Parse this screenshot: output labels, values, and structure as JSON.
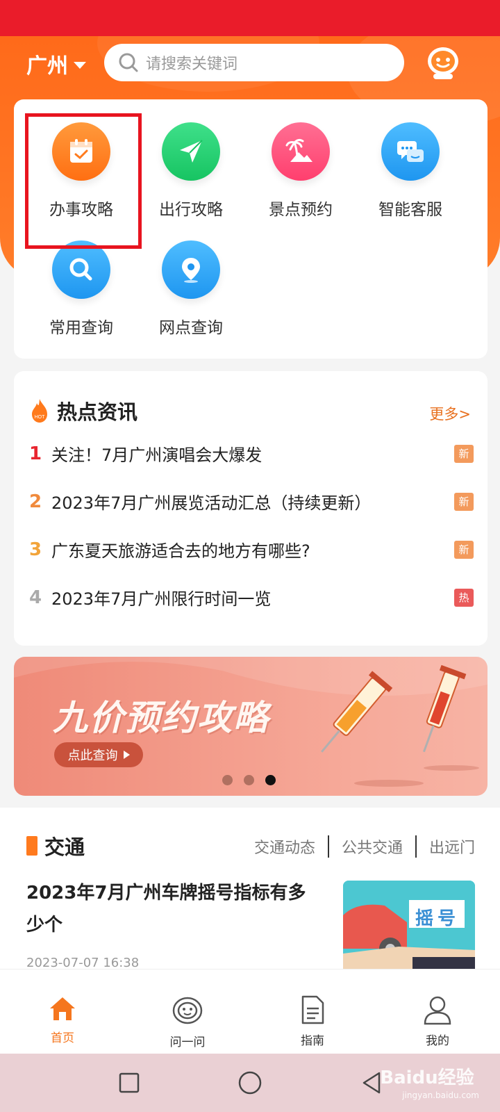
{
  "header": {
    "city": "广州",
    "search_placeholder": "请搜索关键词"
  },
  "quick_links": [
    {
      "label": "办事攻略",
      "icon": "calendar-check-icon",
      "color": "#ff7a1c"
    },
    {
      "label": "出行攻略",
      "icon": "paper-plane-icon",
      "color": "#1fcf6c"
    },
    {
      "label": "景点预约",
      "icon": "palm-tree-icon",
      "color": "#ff4f7b"
    },
    {
      "label": "智能客服",
      "icon": "chat-bubbles-icon",
      "color": "#28a6f6"
    },
    {
      "label": "常用查询",
      "icon": "magnifier-icon",
      "color": "#29a8f7"
    },
    {
      "label": "网点查询",
      "icon": "location-pin-icon",
      "color": "#2b9df5"
    }
  ],
  "news": {
    "title": "热点资讯",
    "more": "更多>",
    "items": [
      {
        "rank": "1",
        "text": "关注！7月广州演唱会大爆发",
        "tag": "新",
        "rank_color": "#e8252f",
        "tag_color": "#f39a5c"
      },
      {
        "rank": "2",
        "text": "2023年7月广州展览活动汇总（持续更新）",
        "tag": "新",
        "rank_color": "#f08a3c",
        "tag_color": "#f39a5c"
      },
      {
        "rank": "3",
        "text": "广东夏天旅游适合去的地方有哪些?",
        "tag": "新",
        "rank_color": "#f2a43a",
        "tag_color": "#f39a5c"
      },
      {
        "rank": "4",
        "text": "2023年7月广州限行时间一览",
        "tag": "热",
        "rank_color": "#aaaaaa",
        "tag_color": "#ea5a5a"
      }
    ]
  },
  "banner": {
    "title": "九价预约攻略",
    "button": "点此查询",
    "active_slide": 3,
    "slide_count": 3
  },
  "traffic": {
    "title": "交通",
    "tabs": [
      "交通动态",
      "公共交通",
      "出远门"
    ],
    "article_title": "2023年7月广州车牌摇号指标有多少个",
    "article_date": "2023-07-07 16:38",
    "thumb_text": "摇号"
  },
  "tabbar": [
    {
      "label": "首页",
      "icon": "home-icon",
      "active": true
    },
    {
      "label": "问一问",
      "icon": "robot-icon",
      "active": false
    },
    {
      "label": "指南",
      "icon": "document-icon",
      "active": false
    },
    {
      "label": "我的",
      "icon": "user-icon",
      "active": false
    }
  ],
  "watermark": {
    "text": "Baidu经验",
    "sub": "jingyan.baidu.com"
  }
}
